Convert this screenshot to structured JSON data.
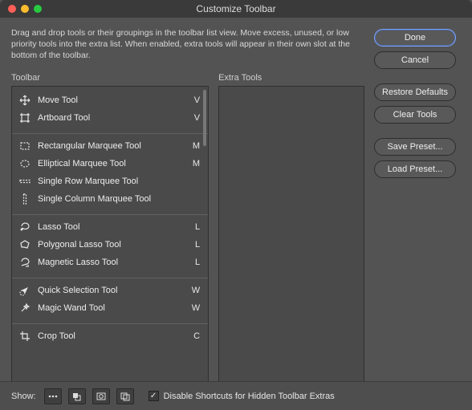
{
  "window": {
    "title": "Customize Toolbar",
    "traffic": {
      "close": "#ff5f57",
      "min": "#ffbd2e",
      "max": "#28c940"
    }
  },
  "instructions": "Drag and drop tools or their groupings in the toolbar list view. Move excess, unused, or low priority tools into the extra list. When enabled, extra tools will appear in their own slot at the bottom of the toolbar.",
  "columns": {
    "toolbar": "Toolbar",
    "extra": "Extra Tools"
  },
  "groups": [
    {
      "tools": [
        {
          "name": "Move Tool",
          "key": "V",
          "icon": "move"
        },
        {
          "name": "Artboard Tool",
          "key": "V",
          "icon": "artboard"
        }
      ]
    },
    {
      "tools": [
        {
          "name": "Rectangular Marquee Tool",
          "key": "M",
          "icon": "rect-marquee"
        },
        {
          "name": "Elliptical Marquee Tool",
          "key": "M",
          "icon": "ellipse-marquee"
        },
        {
          "name": "Single Row Marquee Tool",
          "key": "",
          "icon": "row-marquee"
        },
        {
          "name": "Single Column Marquee Tool",
          "key": "",
          "icon": "col-marquee"
        }
      ]
    },
    {
      "tools": [
        {
          "name": "Lasso Tool",
          "key": "L",
          "icon": "lasso"
        },
        {
          "name": "Polygonal Lasso Tool",
          "key": "L",
          "icon": "poly-lasso"
        },
        {
          "name": "Magnetic Lasso Tool",
          "key": "L",
          "icon": "mag-lasso"
        }
      ]
    },
    {
      "tools": [
        {
          "name": "Quick Selection Tool",
          "key": "W",
          "icon": "quick-sel"
        },
        {
          "name": "Magic Wand Tool",
          "key": "W",
          "icon": "wand"
        }
      ]
    },
    {
      "tools": [
        {
          "name": "Crop Tool",
          "key": "C",
          "icon": "crop"
        }
      ]
    }
  ],
  "sidebar": {
    "done": "Done",
    "cancel": "Cancel",
    "restore": "Restore Defaults",
    "clear": "Clear Tools",
    "save_preset": "Save Preset...",
    "load_preset": "Load Preset..."
  },
  "footer": {
    "show_label": "Show:",
    "checkbox_label": "Disable Shortcuts for Hidden Toolbar Extras",
    "checked": true
  }
}
